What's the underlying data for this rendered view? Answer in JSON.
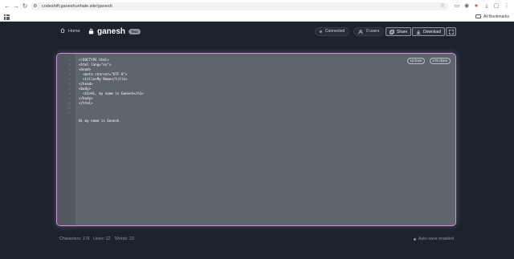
{
  "browser": {
    "url": "codeshift.ganeshunhale.site/ganesh",
    "bookmarks_label": "All Bookmarks",
    "nav": {
      "back": "←",
      "forward": "→",
      "reload": "↻"
    },
    "icons": [
      "site-info-icon",
      "star-icon",
      "cast-icon",
      "profile-icon",
      "extension-red-icon",
      "download-icon",
      "extensions-icon",
      "menu-icon"
    ]
  },
  "header": {
    "home_label": "Home",
    "doc_name": "ganesh",
    "doc_badge": "Text",
    "connection_status": "Connected",
    "users_label": "0 users",
    "share_label": "Share",
    "download_label": "Download"
  },
  "editor": {
    "lines_chip": "12 lines",
    "chars_chip": "176 chars",
    "line_numbers": [
      "1",
      "2",
      "3",
      "4",
      "5",
      "6",
      "7",
      "8",
      "9",
      "10",
      "11",
      "12"
    ],
    "code_lines": [
      "<!DOCTYPE html>",
      "<html lang=\"en\">",
      "<head>",
      "  <meta charset=\"UTF-8\">",
      "  <title>My Name</title>",
      "</head>",
      "<body>",
      "  <h1>Hi, my name is Ganesh</h1>",
      "</body>",
      "</html>",
      "",
      "Hi my name is Ganesh."
    ]
  },
  "footer": {
    "characters": "Characters: 176",
    "lines": "Lines: 12",
    "words": "Words: 23",
    "autosave": "Auto-save enabled"
  },
  "colors": {
    "background": "#1c232d",
    "editor_bg": "#5f656d",
    "editor_border": "#c994d6",
    "text": "#cfd6df"
  }
}
